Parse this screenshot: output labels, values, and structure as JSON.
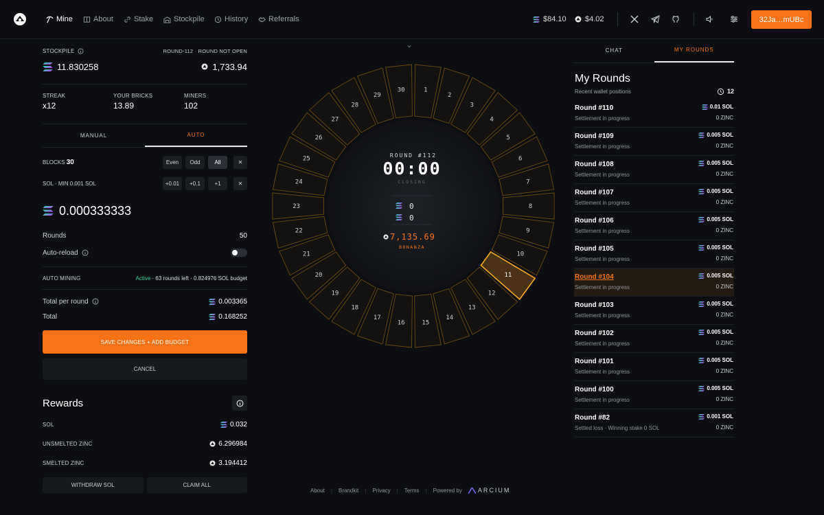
{
  "nav": {
    "items": [
      {
        "label": "Mine",
        "icon": "pickaxe-icon",
        "active": true
      },
      {
        "label": "About",
        "icon": "book-icon"
      },
      {
        "label": "Stake",
        "icon": "link-icon"
      },
      {
        "label": "Stockpile",
        "icon": "warehouse-icon"
      },
      {
        "label": "History",
        "icon": "history-icon"
      },
      {
        "label": "Referrals",
        "icon": "handshake-icon"
      }
    ],
    "sol_price": "$84.10",
    "zinc_price": "$4.02",
    "wallet": "32Ja…mUBc"
  },
  "left": {
    "stockpile_label": "STOCKPILE",
    "round_label": "ROUND-112",
    "round_status": "ROUND NOT OPEN",
    "stockpile_value": "11.830258",
    "zinc_value": "1,733.94",
    "stats": [
      {
        "label": "STREAK",
        "value": "x12"
      },
      {
        "label": "YOUR BRICKS",
        "value": "13.89"
      },
      {
        "label": "MINERS",
        "value": "102"
      }
    ],
    "mode_tabs": [
      "MANUAL",
      "AUTO"
    ],
    "blocks_label": "BLOCKS",
    "blocks_value": "30",
    "block_chips": [
      "Even",
      "Odd",
      "All"
    ],
    "sol_label": "SOL",
    "sol_min": "· MIN 0.001 SOL",
    "sol_chips": [
      "+0.01",
      "+0.1",
      "+1"
    ],
    "clear_glyph": "✕",
    "amount": "0.000333333",
    "rounds_label": "Rounds",
    "rounds_value": "50",
    "autoreload_label": "Auto-reload",
    "automining_label": "AUTO MINING",
    "automining_active": "Active",
    "automining_detail": "· 63 rounds left · 0.824976 SOL budget",
    "total_per_round_label": "Total per round",
    "total_per_round_value": "0.003365",
    "total_label": "Total",
    "total_value": "0.168252",
    "save_button": "SAVE CHANGES + ADD BUDGET",
    "cancel_button": "CANCEL",
    "rewards_title": "Rewards",
    "rewards": [
      {
        "label": "SOL",
        "value": "0.032",
        "icon": "sol"
      },
      {
        "label": "UNSMELTED ZINC",
        "value": "6.296984",
        "icon": "zinc"
      },
      {
        "label": "SMELTED ZINC",
        "value": "3.194412",
        "icon": "zinc"
      }
    ],
    "withdraw_button": "WITHDRAW SOL",
    "claim_button": "CLAIM ALL"
  },
  "wheel": {
    "round_label": "ROUND #112",
    "timer": "00:00",
    "status": "CLOSING",
    "sol_amount": "0",
    "sol_amount2": "0",
    "bonanza_value": "7,135.69",
    "bonanza_label": "BONANZA",
    "chevron_glyph": "⌄",
    "selected_block": 11,
    "block_count": 30
  },
  "footer": {
    "links": [
      "About",
      "Brandkit",
      "Privacy",
      "Terms"
    ],
    "powered": "Powered by",
    "brand": "ARCIUM"
  },
  "right": {
    "tabs": [
      "CHAT",
      "MY ROUNDS"
    ],
    "title": "My Rounds",
    "subtitle": "Recent wallet positions",
    "count": "12",
    "rounds": [
      {
        "name": "Round #110",
        "status": "Settlement in progress",
        "sol": "0.01 SOL",
        "zinc": "0 ZINC"
      },
      {
        "name": "Round #109",
        "status": "Settlement in progress",
        "sol": "0.005 SOL",
        "zinc": "0 ZINC"
      },
      {
        "name": "Round #108",
        "status": "Settlement in progress",
        "sol": "0.005 SOL",
        "zinc": "0 ZINC"
      },
      {
        "name": "Round #107",
        "status": "Settlement in progress",
        "sol": "0.005 SOL",
        "zinc": "0 ZINC"
      },
      {
        "name": "Round #106",
        "status": "Settlement in progress",
        "sol": "0.005 SOL",
        "zinc": "0 ZINC"
      },
      {
        "name": "Round #105",
        "status": "Settlement in progress",
        "sol": "0.005 SOL",
        "zinc": "0 ZINC"
      },
      {
        "name": "Round #104",
        "status": "Settlement in progress",
        "sol": "0.005 SOL",
        "zinc": "0 ZINC"
      },
      {
        "name": "Round #103",
        "status": "Settlement in progress",
        "sol": "0.005 SOL",
        "zinc": "0 ZINC"
      },
      {
        "name": "Round #102",
        "status": "Settlement in progress",
        "sol": "0.005 SOL",
        "zinc": "0 ZINC"
      },
      {
        "name": "Round #101",
        "status": "Settlement in progress",
        "sol": "0.005 SOL",
        "zinc": "0 ZINC"
      },
      {
        "name": "Round #100",
        "status": "Settlement in progress",
        "sol": "0.005 SOL",
        "zinc": "0 ZINC"
      },
      {
        "name": "Round #82",
        "status": "Settled loss · Winning stake 0 SOL",
        "sol": "0.001 SOL",
        "zinc": "0 ZINC"
      }
    ],
    "highlighted_index": 6
  },
  "colors": {
    "accent": "#f97316",
    "active_green": "#34d399",
    "bg": "#0c0e11"
  }
}
